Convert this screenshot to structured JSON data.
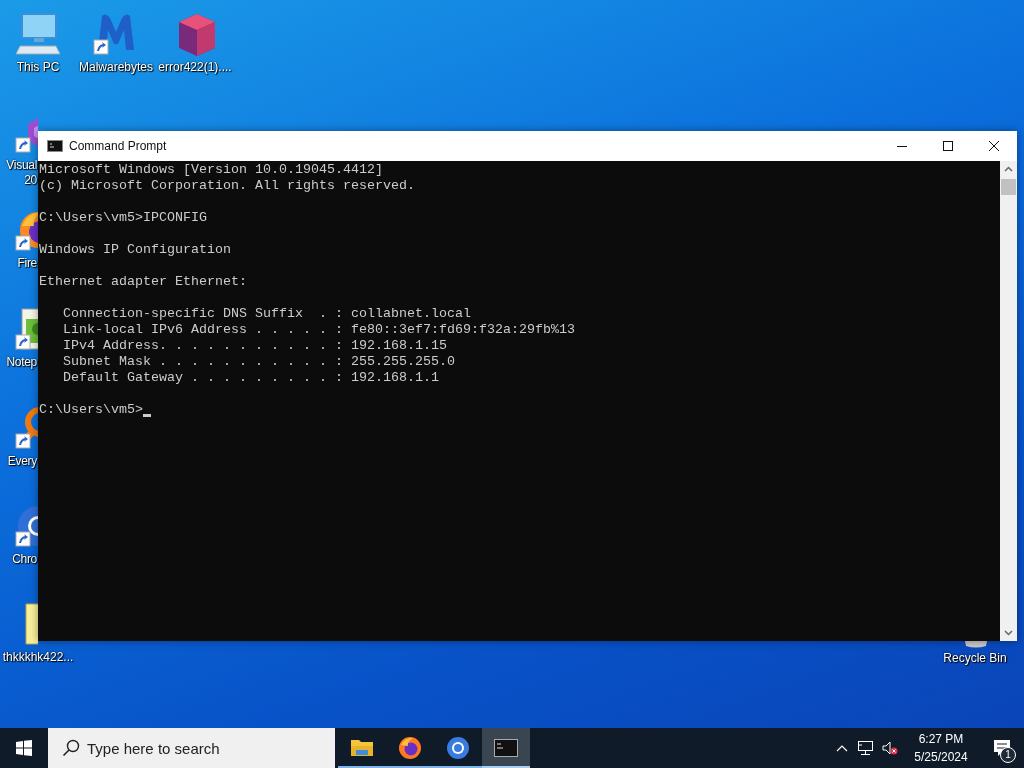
{
  "desktop": {
    "icons": [
      {
        "kind": "computer",
        "label_lines": [
          "This PC"
        ],
        "shortcut": false
      },
      {
        "kind": "m_logo",
        "label_lines": [
          "Malwarebytes"
        ],
        "shortcut": true
      },
      {
        "kind": "cube",
        "label_lines": [
          "error422(1)...."
        ],
        "shortcut": false
      },
      {
        "kind": "ribbon",
        "label_lines": [
          "Visual",
          "20"
        ],
        "shortcut": true
      },
      {
        "kind": "fox",
        "label_lines": [
          "Fire"
        ],
        "shortcut": true
      },
      {
        "kind": "notepad",
        "label_lines": [
          "Notep"
        ],
        "shortcut": true
      },
      {
        "kind": "magnifier",
        "label_lines": [
          "Every"
        ],
        "shortcut": true
      },
      {
        "kind": "ring",
        "label_lines": [
          "Chro"
        ],
        "shortcut": true
      },
      {
        "kind": "file",
        "label_lines": [
          "thkkkhk422..."
        ],
        "shortcut": false
      },
      {
        "kind": "bin",
        "label_lines": [
          "Recycle Bin"
        ]
      }
    ]
  },
  "window": {
    "title": "Command Prompt",
    "console": {
      "blocks": [
        {
          "kind": "text",
          "lines": [
            "Microsoft Windows [Version 10.0.19045.4412]",
            "(c) Microsoft Corporation. All rights reserved."
          ]
        },
        {
          "kind": "text",
          "lines": [
            "C:\\Users\\vm5>IPCONFIG"
          ]
        },
        {
          "kind": "title",
          "lines": [
            "Windows IP Configuration"
          ]
        },
        {
          "kind": "text",
          "lines": [
            "Ethernet adapter Ethernet:"
          ]
        },
        {
          "kind": "text",
          "lines": [
            "   Connection-specific DNS Suffix  . : collabnet.local",
            "   Link-local IPv6 Address . . . . . : fe80::3ef7:fd69:f32a:29fb%13",
            "   IPv4 Address. . . . . . . . . . . : 192.168.1.15",
            "   Subnet Mask . . . . . . . . . . . : 255.255.255.0",
            "   Default Gateway . . . . . . . . . : 192.168.1.1"
          ]
        },
        {
          "kind": "prompt",
          "lines": [
            "C:\\Users\\vm5>"
          ]
        }
      ]
    }
  },
  "taskbar": {
    "search": {
      "placeholder": "Type here to search"
    },
    "apps": [
      {
        "kind": "folder",
        "running": true,
        "selected": false
      },
      {
        "kind": "fox",
        "running": true,
        "selected": false
      },
      {
        "kind": "ring",
        "running": true,
        "selected": false
      },
      {
        "kind": "terminal",
        "running": true,
        "selected": true
      }
    ],
    "tray": {
      "time": "6:27 PM",
      "date": "5/25/2024",
      "notification_count": "1"
    }
  }
}
